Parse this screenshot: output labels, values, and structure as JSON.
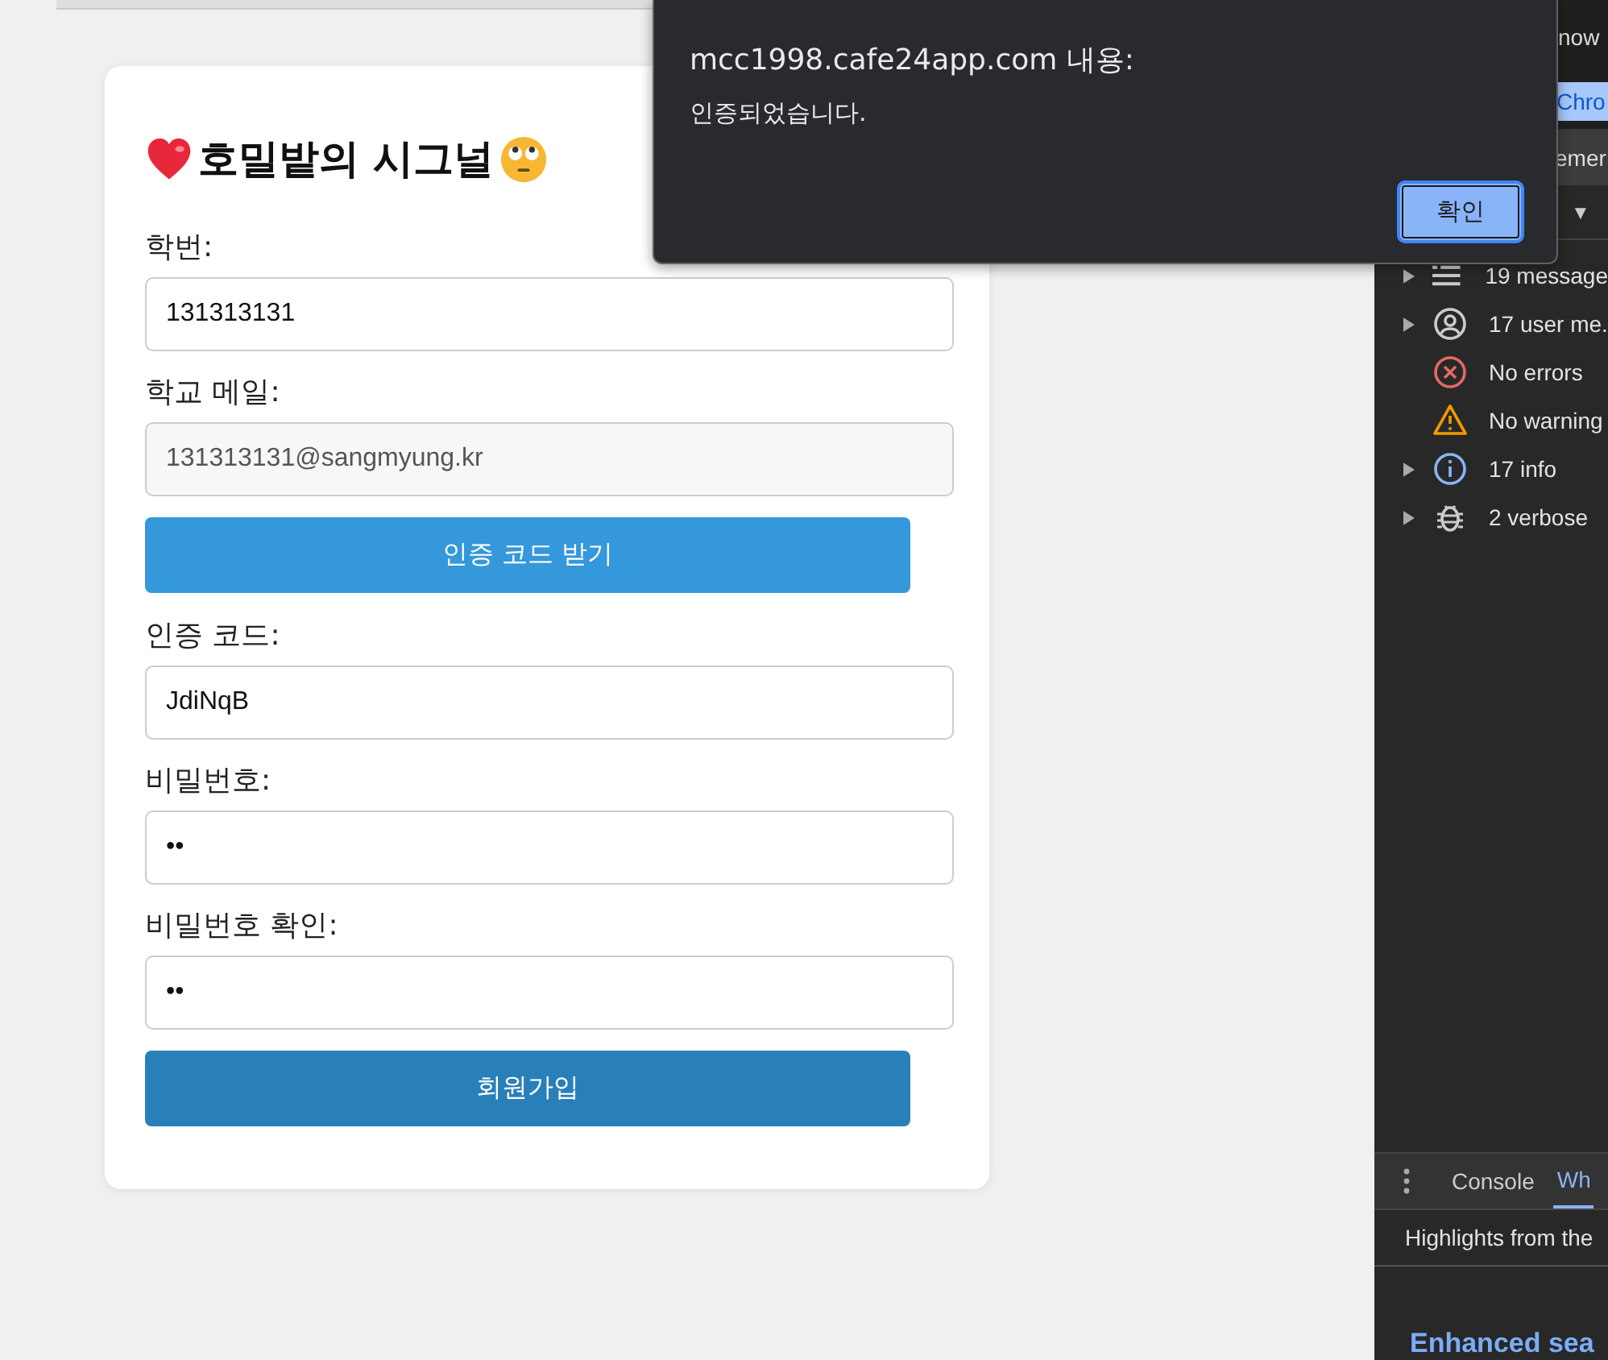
{
  "form": {
    "title": "호밀밭의 시그널",
    "items": [
      {
        "kind": "field",
        "label": "학번:",
        "value": "131313131",
        "readonly": false
      },
      {
        "kind": "field",
        "label": "학교 메일:",
        "value": "131313131@sangmyung.kr",
        "readonly": true
      },
      {
        "kind": "button",
        "label": "인증 코드 받기",
        "color": "#3498db"
      },
      {
        "kind": "field",
        "label": "인증 코드:",
        "value": "JdiNqB",
        "readonly": false
      },
      {
        "kind": "field",
        "label": "비밀번호:",
        "value": "••",
        "readonly": false
      },
      {
        "kind": "field",
        "label": "비밀번호 확인:",
        "value": "••",
        "readonly": false
      },
      {
        "kind": "button",
        "label": "회원가입",
        "color": "#2980b9"
      }
    ]
  },
  "dialog": {
    "title": "mcc1998.cafe24app.com 내용:",
    "message": "인증되었습니다.",
    "button": "확인"
  },
  "devtools": {
    "top_text": "now",
    "banner_button": "Chro",
    "panel_tab": "emer",
    "dropdown": "▼",
    "messages": [
      {
        "kind": "messages",
        "label": "19 message",
        "expandable": true
      },
      {
        "kind": "user",
        "label": "17 user me.",
        "expandable": true
      },
      {
        "kind": "error",
        "label": "No errors",
        "expandable": false
      },
      {
        "kind": "warning",
        "label": "No warning",
        "expandable": false
      },
      {
        "kind": "info",
        "label": "17 info",
        "expandable": true
      },
      {
        "kind": "verbose",
        "label": "2 verbose",
        "expandable": true
      }
    ],
    "drawer_tabs": [
      {
        "label": "Console",
        "selected": false
      },
      {
        "label": "Wh",
        "selected": true
      }
    ],
    "highlights": "Highlights from the",
    "heading": "Enhanced sea"
  }
}
